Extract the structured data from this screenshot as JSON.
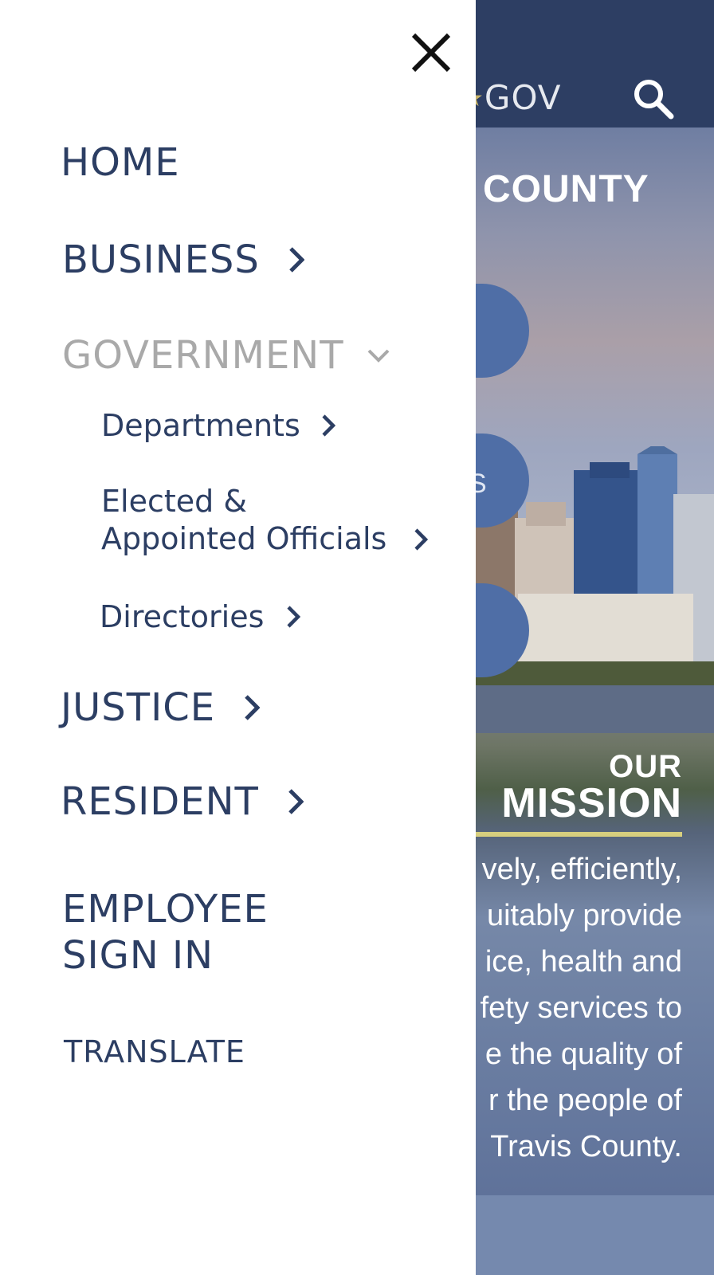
{
  "background": {
    "logo_text": "GOV",
    "hero_heading": "COUNTY",
    "circle_partial_letter": "S",
    "mission": {
      "our": "OUR",
      "title": "MISSION",
      "lines": [
        "vely, efficiently,",
        "uitably provide",
        "ice, health and",
        "fety services to",
        "e the quality of",
        "r the people of",
        "Travis County."
      ]
    }
  },
  "menu": {
    "close_icon": "close-icon",
    "items": [
      {
        "label": "HOME"
      },
      {
        "label": "BUSINESS",
        "icon": "chevron-right-icon"
      },
      {
        "label": "GOVERNMENT",
        "icon": "chevron-down-icon",
        "state": "expanded"
      },
      {
        "label": "JUSTICE",
        "icon": "chevron-right-icon"
      },
      {
        "label": "RESIDENT",
        "icon": "chevron-right-icon"
      },
      {
        "label_line1": "EMPLOYEE",
        "label_line2": "SIGN IN"
      },
      {
        "label": "TRANSLATE"
      }
    ],
    "government_sub": [
      {
        "label": "Departments"
      },
      {
        "label_line1": "Elected &",
        "label_line2": "Appointed Officials"
      },
      {
        "label": "Directories"
      }
    ]
  },
  "colors": {
    "menu_text": "#2c3e63",
    "menu_active_text": "#a9a9a9",
    "header_bg": "#2d3e63",
    "accent_line": "#d8cf7e"
  }
}
